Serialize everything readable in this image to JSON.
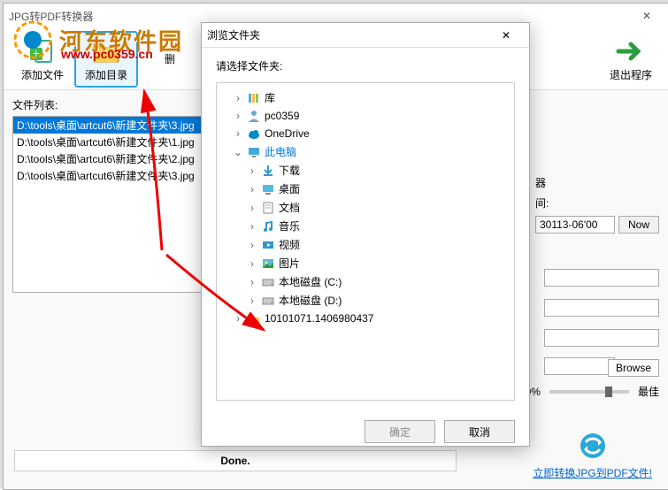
{
  "main": {
    "title": "JPG转PDF转换器",
    "close": "✕"
  },
  "watermark": {
    "text": "河东软件园",
    "url": "www.pc0359.cn"
  },
  "toolbar": {
    "add_file": "添加文件",
    "add_dir": "添加目录",
    "delete": "删",
    "exit": "退出程序"
  },
  "file_list": {
    "label": "文件列表:",
    "items": [
      "D:\\tools\\桌面\\artcut6\\新建文件夹\\3.jpg",
      "D:\\tools\\桌面\\artcut6\\新建文件夹\\1.jpg",
      "D:\\tools\\桌面\\artcut6\\新建文件夹\\2.jpg",
      "D:\\tools\\桌面\\artcut6\\新建文件夹\\3.jpg"
    ]
  },
  "right": {
    "label1": "器",
    "label2": "间:",
    "date_value": "30113-06'00",
    "now": "Now",
    "browse": "Browse",
    "quality_pct": "80%",
    "quality_best": "最佳"
  },
  "status": "Done.",
  "convert": "立即转换JPG到PDF文件!",
  "dialog": {
    "title": "浏览文件夹",
    "close": "✕",
    "prompt": "请选择文件夹:",
    "tree": [
      {
        "arrow": ">",
        "icon": "library",
        "label": "库",
        "indent": 1
      },
      {
        "arrow": ">",
        "icon": "user",
        "label": "pc0359",
        "indent": 1
      },
      {
        "arrow": ">",
        "icon": "cloud",
        "label": "OneDrive",
        "indent": 1
      },
      {
        "arrow": "v",
        "icon": "pc",
        "label": "此电脑",
        "indent": 1,
        "sel": true
      },
      {
        "arrow": ">",
        "icon": "download",
        "label": "下载",
        "indent": 2
      },
      {
        "arrow": ">",
        "icon": "desktop",
        "label": "桌面",
        "indent": 2
      },
      {
        "arrow": ">",
        "icon": "doc",
        "label": "文档",
        "indent": 2
      },
      {
        "arrow": ">",
        "icon": "music",
        "label": "音乐",
        "indent": 2
      },
      {
        "arrow": ">",
        "icon": "video",
        "label": "视频",
        "indent": 2
      },
      {
        "arrow": ">",
        "icon": "pic",
        "label": "图片",
        "indent": 2
      },
      {
        "arrow": ">",
        "icon": "disk",
        "label": "本地磁盘 (C:)",
        "indent": 2
      },
      {
        "arrow": ">",
        "icon": "disk",
        "label": "本地磁盘 (D:)",
        "indent": 2
      },
      {
        "arrow": ">",
        "icon": "folder",
        "label": "10101071.1406980437",
        "indent": 1
      }
    ],
    "ok": "确定",
    "cancel": "取消"
  }
}
